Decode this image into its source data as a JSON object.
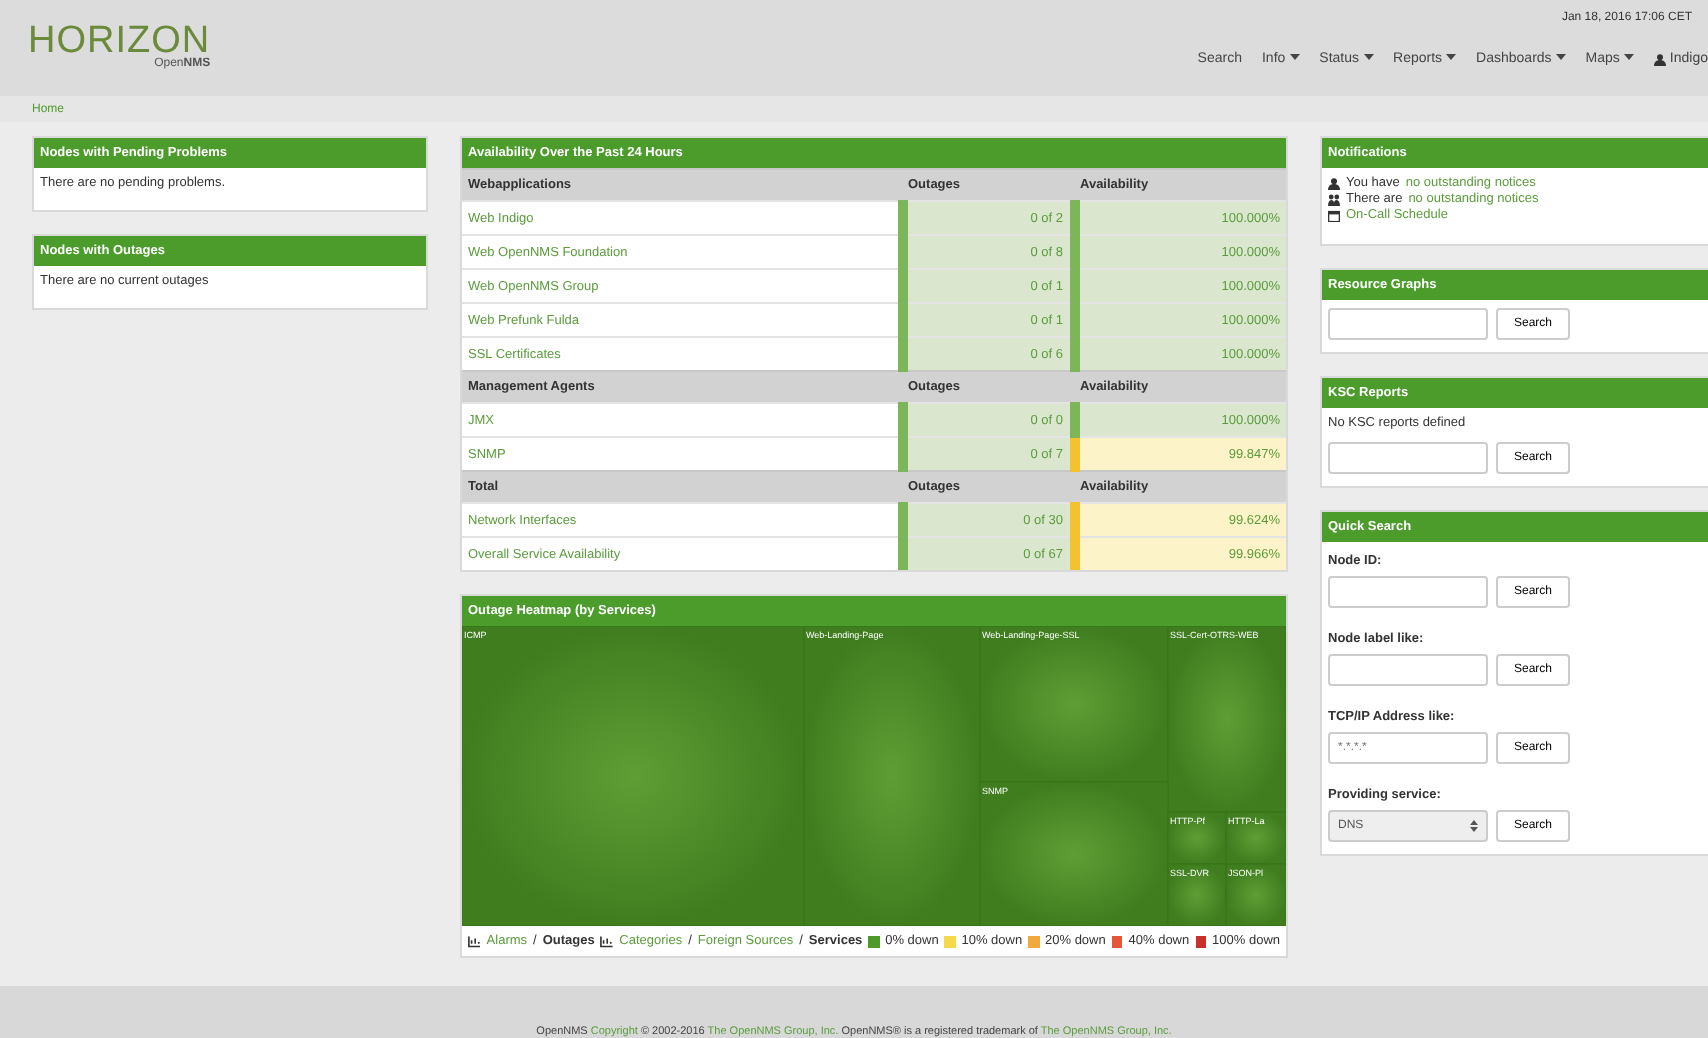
{
  "header": {
    "logo": "HORIZON",
    "logo_sub": "Open**NMS**",
    "datetime": "Jan 18, 2016 17:06 CET",
    "nav": [
      {
        "label": "Search",
        "dropdown": false
      },
      {
        "label": "Info",
        "dropdown": true
      },
      {
        "label": "Status",
        "dropdown": true
      },
      {
        "label": "Reports",
        "dropdown": true
      },
      {
        "label": "Dashboards",
        "dropdown": true
      },
      {
        "label": "Maps",
        "dropdown": true
      }
    ],
    "user": "Indigo"
  },
  "breadcrumb": "Home",
  "left_panels": [
    {
      "title": "Nodes with Pending Problems",
      "text": "There are no pending problems."
    },
    {
      "title": "Nodes with Outages",
      "text": "There are no current outages"
    }
  ],
  "availability": {
    "title": "Availability Over the Past 24 Hours",
    "sections": [
      {
        "heading": "Webapplications",
        "col_outages": "Outages",
        "col_availability": "Availability",
        "rows": [
          {
            "name": "Web Indigo",
            "outages": "0 of 2",
            "availability": "100.000%",
            "kind": "ok"
          },
          {
            "name": "Web OpenNMS Foundation",
            "outages": "0 of 8",
            "availability": "100.000%",
            "kind": "ok"
          },
          {
            "name": "Web OpenNMS Group",
            "outages": "0 of 1",
            "availability": "100.000%",
            "kind": "ok"
          },
          {
            "name": "Web Prefunk Fulda",
            "outages": "0 of 1",
            "availability": "100.000%",
            "kind": "ok"
          },
          {
            "name": "SSL Certificates",
            "outages": "0 of 6",
            "availability": "100.000%",
            "kind": "ok"
          }
        ]
      },
      {
        "heading": "Management Agents",
        "col_outages": "Outages",
        "col_availability": "Availability",
        "rows": [
          {
            "name": "JMX",
            "outages": "0 of 0",
            "availability": "100.000%",
            "kind": "ok"
          },
          {
            "name": "SNMP",
            "outages": "0 of 7",
            "availability": "99.847%",
            "kind": "warn"
          }
        ]
      },
      {
        "heading": "Total",
        "col_outages": "Outages",
        "col_availability": "Availability",
        "rows": [
          {
            "name": "Network Interfaces",
            "outages": "0 of 30",
            "availability": "99.624%",
            "kind": "warn"
          },
          {
            "name": "Overall Service Availability",
            "outages": "0 of 67",
            "availability": "99.966%",
            "kind": "warn"
          }
        ]
      }
    ]
  },
  "heatmap": {
    "title": "Outage Heatmap (by Services)",
    "tiles": [
      "ICMP",
      "Web-Landing-Page",
      "Web-Landing-Page-SSL",
      "SSL-Cert-OTRS-WEB",
      "SNMP",
      "HTTP-Pf",
      "HTTP-La",
      "SSL-DVR",
      "JSON-Pl"
    ],
    "legend_links": [
      {
        "kind": "icon"
      },
      {
        "kind": "link",
        "label": "Alarms"
      },
      {
        "kind": "sep",
        "label": "/"
      },
      {
        "kind": "bold",
        "label": "Outages"
      },
      {
        "kind": "icon"
      },
      {
        "kind": "link",
        "label": "Categories"
      },
      {
        "kind": "sep",
        "label": "/"
      },
      {
        "kind": "link",
        "label": "Foreign Sources"
      },
      {
        "kind": "sep",
        "label": "/"
      },
      {
        "kind": "bold",
        "label": "Services"
      }
    ],
    "legend": [
      {
        "label": "0% down",
        "color": "#4e9a2a"
      },
      {
        "label": "10% down",
        "color": "#f5d94a"
      },
      {
        "label": "20% down",
        "color": "#f0a93b"
      },
      {
        "label": "40% down",
        "color": "#e4553a"
      },
      {
        "label": "100% down",
        "color": "#c9302c"
      }
    ]
  },
  "notifications": {
    "title": "Notifications",
    "items": [
      {
        "kind": "user",
        "prefix": "You have",
        "link": "no outstanding notices"
      },
      {
        "kind": "group",
        "prefix": "There are",
        "link": "no outstanding notices"
      },
      {
        "kind": "calendar",
        "link": "On-Call Schedule"
      }
    ]
  },
  "resource_graphs": {
    "title": "Resource Graphs",
    "button": "Search"
  },
  "ksc_reports": {
    "title": "KSC Reports",
    "text": "No KSC reports defined",
    "button": "Search"
  },
  "quick_search": {
    "title": "Quick Search",
    "fields": [
      {
        "label": "Node ID:",
        "kind": "input",
        "button": "Search"
      },
      {
        "label": "Node label like:",
        "kind": "input",
        "button": "Search"
      },
      {
        "label": "TCP/IP Address like:",
        "kind": "input",
        "placeholder": "*.*.*.*",
        "button": "Search"
      },
      {
        "label": "Providing service:",
        "kind": "select",
        "value": "DNS",
        "button": "Search"
      }
    ]
  },
  "footer": [
    {
      "text": "OpenNMS",
      "link": false
    },
    {
      "text": "Copyright",
      "link": true
    },
    {
      "text": "© 2002-2016",
      "link": false
    },
    {
      "text": "The OpenNMS Group, Inc.",
      "link": true
    },
    {
      "text": "OpenNMS® is a registered trademark of",
      "link": false
    },
    {
      "text": "The OpenNMS Group, Inc.",
      "link": true
    }
  ]
}
